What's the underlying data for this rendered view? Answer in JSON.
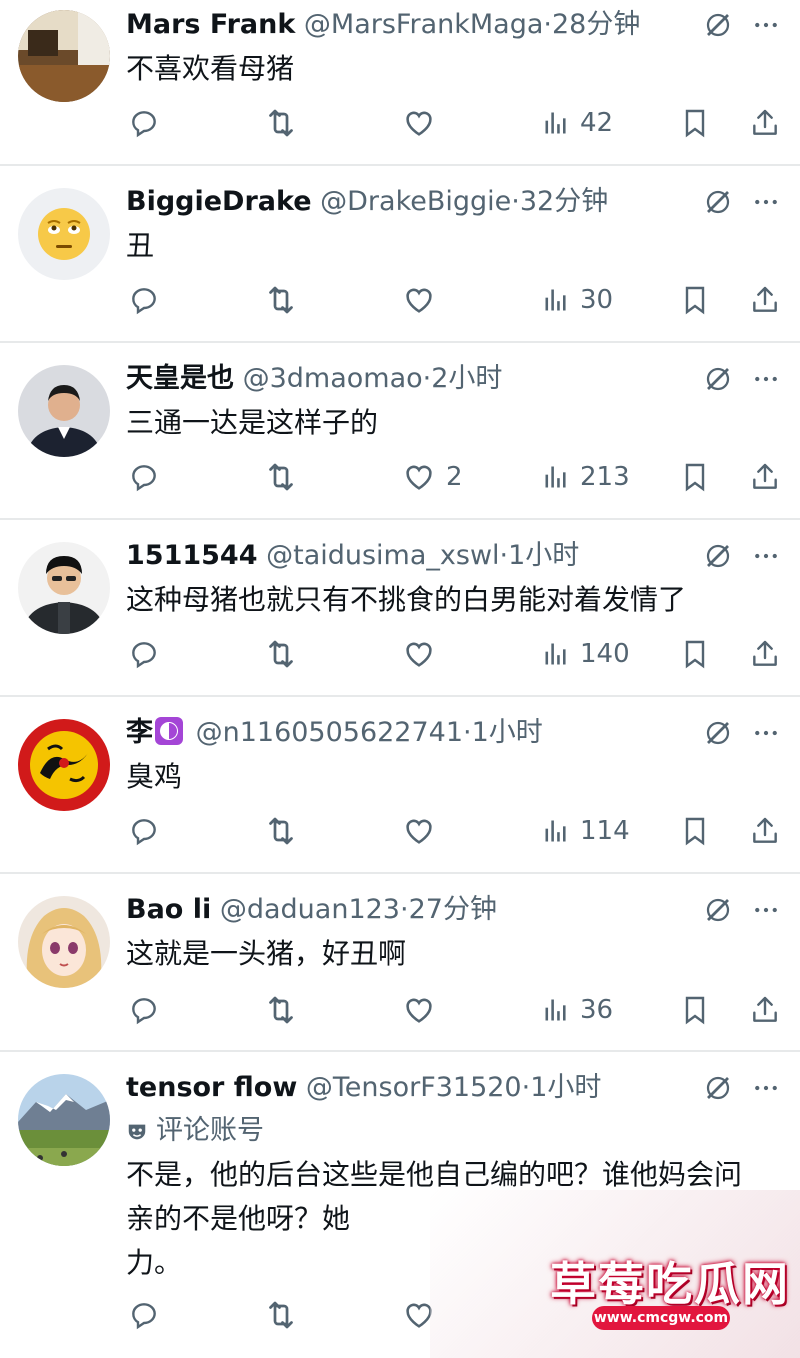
{
  "tweets": [
    {
      "name": "Mars Frank",
      "handle": "@MarsFrankMaga",
      "time": "·28分钟",
      "text": "不喜欢看母猪",
      "likes": "",
      "views": "42"
    },
    {
      "name": "BiggieDrake",
      "handle": "@DrakeBiggie",
      "time": "·32分钟",
      "text": "丑",
      "likes": "",
      "views": "30"
    },
    {
      "name": "天皇是也",
      "handle": "@3dmaomao",
      "time": "·2小时",
      "text": "三通一达是这样子的",
      "likes": "2",
      "views": "213"
    },
    {
      "name": "1511544",
      "handle": "@taidusima_xswl",
      "time": "·1小时",
      "text": "这种母猪也就只有不挑食的白男能对着发情了",
      "likes": "",
      "views": "140"
    },
    {
      "name": "李",
      "handle": "@n1160505622741",
      "time": "·1小时",
      "text": "臭鸡",
      "likes": "",
      "views": "114"
    },
    {
      "name": "Bao li",
      "handle": "@daduan123",
      "time": "·27分钟",
      "text": "这就是一头猪，好丑啊",
      "likes": "",
      "views": "36"
    },
    {
      "name": "tensor flow",
      "handle": "@TensorF31520",
      "time": "·1小时",
      "subnote": "评论账号",
      "text": "不是，他的后台这些是他自己编的吧？谁他妈会问亲的不是他呀？她",
      "text2": "力。",
      "likes": "",
      "views": ""
    }
  ],
  "watermark": {
    "title": "草莓吃瓜网",
    "url": "www.cmcgw.com"
  },
  "icons": {
    "reply": "reply-icon",
    "retweet": "retweet-icon",
    "like": "heart-icon",
    "views": "views-bar-chart-icon",
    "bookmark": "bookmark-icon",
    "share": "share-icon",
    "grok": "grok-slash-icon",
    "more": "more-dots-icon"
  },
  "colors": {
    "text": "#0f1419",
    "secondary": "#536471",
    "divider": "#e7e9ea"
  }
}
